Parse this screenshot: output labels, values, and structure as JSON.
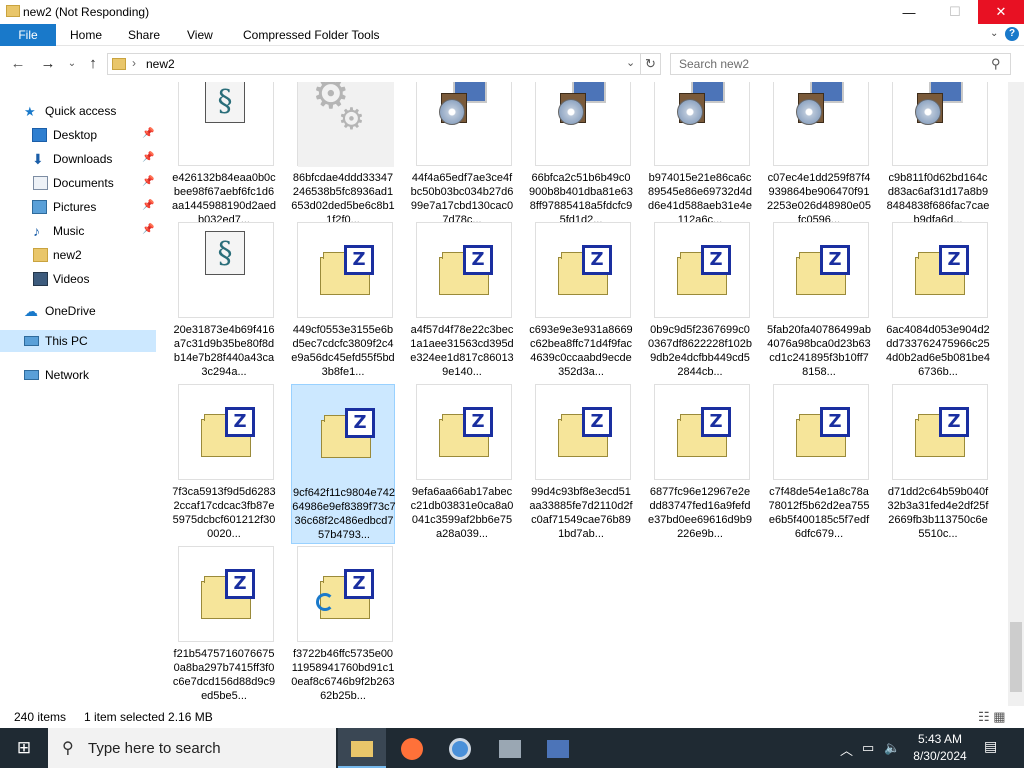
{
  "window": {
    "title": "new2 (Not Responding)",
    "min": "—",
    "max": "☐",
    "close": "✕"
  },
  "ribbon": {
    "tabs": [
      "File",
      "Home",
      "Share",
      "View",
      "Compressed Folder Tools"
    ],
    "help": "?",
    "chevron": "⌄"
  },
  "address": {
    "path": "new2",
    "separator": "›",
    "search_placeholder": "Search new2"
  },
  "nav": {
    "quick_access": "Quick access",
    "items": [
      {
        "label": "Desktop",
        "icon": "desktop-icon",
        "pinned": true
      },
      {
        "label": "Downloads",
        "icon": "downloads-icon",
        "pinned": true
      },
      {
        "label": "Documents",
        "icon": "documents-icon",
        "pinned": true
      },
      {
        "label": "Pictures",
        "icon": "pictures-icon",
        "pinned": true
      },
      {
        "label": "Music",
        "icon": "music-icon",
        "pinned": true
      },
      {
        "label": "new2",
        "icon": "folder-icon",
        "pinned": false
      },
      {
        "label": "Videos",
        "icon": "videos-icon",
        "pinned": false
      }
    ],
    "onedrive": "OneDrive",
    "this_pc": "This PC",
    "network": "Network"
  },
  "files": [
    {
      "name": "e426132b84eaa0b0cbee98f67aebf6fc1d6aa1445988190d2aedb032ed7...",
      "icon": "script-icon"
    },
    {
      "name": "86bfcdae4ddd33347246538b5fc8936ad1653d02ded5be6c8b11f2f0...",
      "icon": "gear-file-icon"
    },
    {
      "name": "44f4a65edf7ae3ce4fbc50b03bc034b27d699e7a17cbd130cac07d78c...",
      "icon": "setup-icon"
    },
    {
      "name": "66bfca2c51b6b49c0900b8b401dba81e638ff97885418a5fdcfc95fd1d2...",
      "icon": "setup-icon"
    },
    {
      "name": "b974015e21e86ca6c89545e86e69732d4dd6e41d588aeb31e4e112a6c...",
      "icon": "setup-icon"
    },
    {
      "name": "c07ec4e1dd259f87f4939864be906470f912253e026d48980e05fc0596...",
      "icon": "setup-icon"
    },
    {
      "name": "c9b811f0d62bd164cd83ac6af31d17a8b98484838f686fac7caeb9dfa6d...",
      "icon": "setup-icon"
    },
    {
      "name": "20e31873e4b69f416a7c31d9b35be80f8db14e7b28f440a43ca3c294a...",
      "icon": "script-icon"
    },
    {
      "name": "449cf0553e3155e6bd5ec7cdcfc3809f2c4e9a56dc45efd55f5bd3b8fe1...",
      "icon": "zip-icon"
    },
    {
      "name": "a4f57d4f78e22c3bec1a1aee31563cd395de324ee1d817c860139e140...",
      "icon": "zip-icon"
    },
    {
      "name": "c693e9e3e931a8669c62bea8ffc71d4f9fac4639c0ccaabd9ecde352d3a...",
      "icon": "zip-icon"
    },
    {
      "name": "0b9c9d5f2367699c00367df8622228f102b9db2e4dcfbb449cd52844cb...",
      "icon": "zip-icon"
    },
    {
      "name": "5fab20fa40786499ab4076a98bca0d23b63cd1c241895f3b10ff78158...",
      "icon": "zip-icon"
    },
    {
      "name": "6ac4084d053e904d2dd733762475966c254d0b2ad6e5b081be46736b...",
      "icon": "zip-icon"
    },
    {
      "name": "7f3ca5913f9d5d62832ccaf17cdcac3fb87e5975dcbcf601212f300020...",
      "icon": "zip-icon"
    },
    {
      "name": "9cf642f11c9804e74264986e9ef8389f73c736c68f2c486edbcd757b4793...",
      "icon": "zip-icon",
      "selected": true
    },
    {
      "name": "9efa6aa66ab17abecc21db03831e0ca8a0041c3599af2bb6e75a28a039...",
      "icon": "zip-icon"
    },
    {
      "name": "99d4c93bf8e3ecd51aa33885fe7d2110d2fc0af71549cae76b891bd7ab...",
      "icon": "zip-icon"
    },
    {
      "name": "6877fc96e12967e2edd83747fed16a9fefde37bd0ee69616d9b9226e9b...",
      "icon": "zip-icon"
    },
    {
      "name": "c7f48de54e1a8c78a78012f5b62d2ea755e6b5f400185c5f7edf6dfc679...",
      "icon": "zip-icon"
    },
    {
      "name": "d71dd2c64b59b040f32b3a31fed4e2df25f2669fb3b113750c6e5510c...",
      "icon": "zip-icon"
    },
    {
      "name": "f21b54757160766750a8ba297b7415ff3f0c6e7dcd156d88d9c9ed5be5...",
      "icon": "zip-icon"
    },
    {
      "name": "f3722b46ffc5735e0011958941760bd91c10eaf8c6746b9f2b26362b25b...",
      "icon": "zip-icon",
      "busy": true
    }
  ],
  "status": {
    "count": "240 items",
    "selection": "1 item selected  2.16 MB"
  },
  "taskbar": {
    "search_placeholder": "Type here to search",
    "time": "5:43 AM",
    "date": "8/30/2024"
  }
}
